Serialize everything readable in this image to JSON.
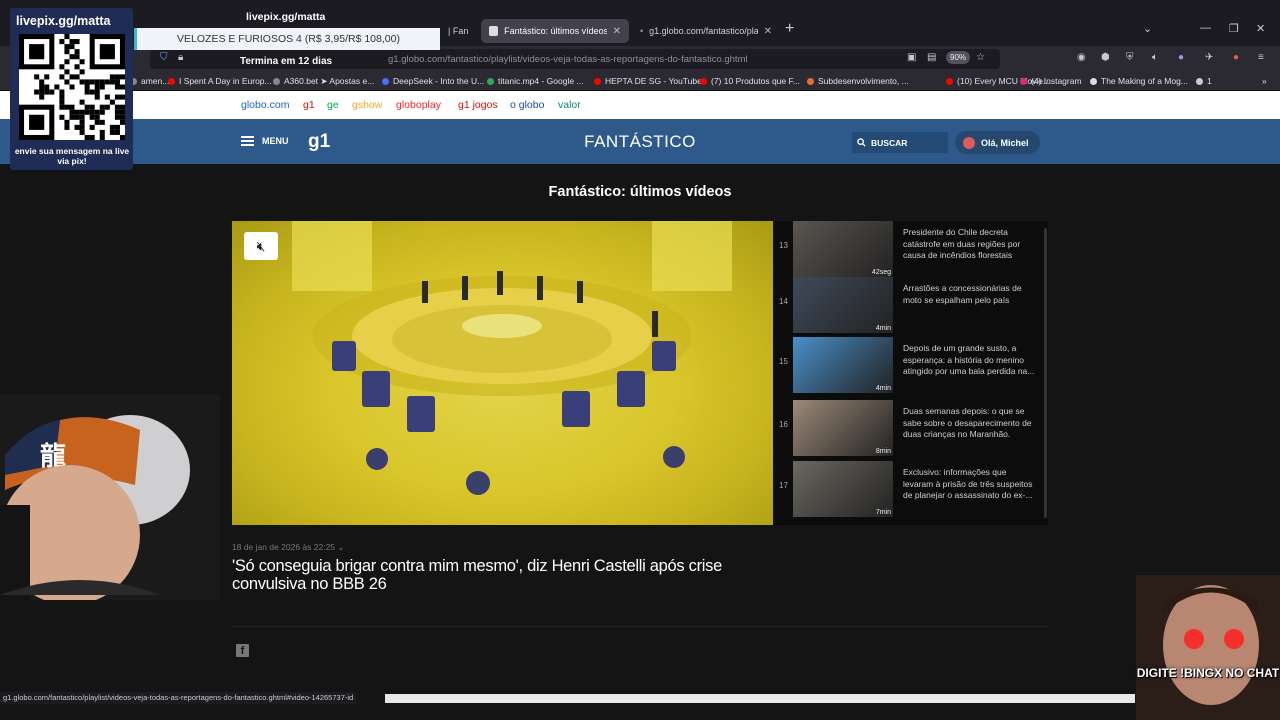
{
  "browser": {
    "tabs": [
      {
        "title": "| Fan"
      },
      {
        "title": "Fantástico: últimos vídeos | Fant",
        "active": true
      },
      {
        "title": "g1.globo.com/fantastico/playli"
      }
    ],
    "url": "g1.globo.com/fantastico/playlist/videos-veja-todas-as-reportagens-do-fantastico.ghtml",
    "zoom": "90%",
    "bookmarks": [
      {
        "label": "amen...",
        "color": "#888"
      },
      {
        "label": "I Spent A Day in Europ...",
        "color": "#ff0000"
      },
      {
        "label": "A360.bet ➤ Apostas e...",
        "color": "#888"
      },
      {
        "label": "DeepSeek - Into the U...",
        "color": "#4d6bfe"
      },
      {
        "label": "titanic.mp4 - Google ...",
        "color": "#34a853"
      },
      {
        "label": "HEPTA DE SG - YouTube",
        "color": "#ff0000"
      },
      {
        "label": "(7) 10 Produtos que F...",
        "color": "#ff0000"
      },
      {
        "label": "Subdesenvolvimento, ...",
        "color": "#e8702a"
      },
      {
        "label": "(10) Every MCU Movie...",
        "color": "#ff0000"
      },
      {
        "label": "(4) Instagram",
        "color": "#d62976"
      },
      {
        "label": "The Making of a Mog...",
        "color": "#ddd"
      },
      {
        "label": "1",
        "color": "#ccc"
      }
    ],
    "status_url": "g1.globo.com/fantastico/playlist/videos-veja-todas-as-reportagens-do-fantastico.ghtml#video-14265737-id"
  },
  "globo_nav": [
    {
      "label": "globo.com",
      "color": "#1565c0"
    },
    {
      "label": "g1",
      "color": "#c4170c"
    },
    {
      "label": "ge",
      "color": "#06aa48"
    },
    {
      "label": "gshow",
      "color": "#f5a623"
    },
    {
      "label": "globoplay",
      "color": "#e8232d"
    },
    {
      "label": "g1 jogos",
      "color": "#c4170c"
    },
    {
      "label": "o globo",
      "color": "#1c4c9c"
    },
    {
      "label": "valor",
      "color": "#0f7f7f"
    }
  ],
  "header": {
    "menu_label": "MENU",
    "logo": "g1",
    "section": "FANTÁSTICO",
    "search_label": "BUSCAR",
    "user_greeting": "Olá, Michel"
  },
  "page": {
    "title": "Fantástico: últimos vídeos",
    "date": "18 de jan de 2026 às 22:25",
    "headline": "'Só conseguia brigar contra mim mesmo', diz Henri Castelli após crise convulsiva no BBB 26"
  },
  "playlist": [
    {
      "num": "13",
      "title": "Presidente do Chile decreta catástrofe em duas regiões por causa de incêndios florestais",
      "duration": "42seg",
      "thumb": "#5a5550"
    },
    {
      "num": "14",
      "title": "Arrastões a concessionárias de moto se espalham pelo país",
      "duration": "4min",
      "thumb": "#3f4a5a"
    },
    {
      "num": "15",
      "title": "Depois de um grande susto, a esperança: a história do menino atingido por uma bala perdida na...",
      "duration": "4min",
      "thumb": "#4a8fc9"
    },
    {
      "num": "16",
      "title": "Duas semanas depois: o que se sabe sobre o desaparecimento de duas crianças no Maranhão.",
      "duration": "8min",
      "thumb": "#9b8a78"
    },
    {
      "num": "17",
      "title": "Exclusivo: informações que levaram à prisão de três suspeitos de planejar o assassinato do ex-...",
      "duration": "7min",
      "thumb": "#6b6860"
    }
  ],
  "overlay": {
    "qr_title": "livepix.gg/matta",
    "qr_caption": "envie sua mensagem na live via pix!",
    "top_text": "livepix.gg/matta",
    "banner": "VELOZES E FURIOSOS 4 (R$ 3,95/R$ 108,00)",
    "banner_sub": "Termina em 12 dias",
    "bingx": "DIGITE !BINGX NO CHAT"
  }
}
